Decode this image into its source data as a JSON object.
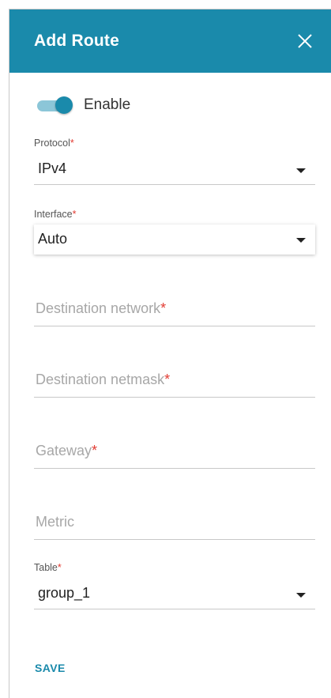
{
  "dialog": {
    "title": "Add Route",
    "close_icon": "close-icon"
  },
  "enable": {
    "label": "Enable",
    "state": "on"
  },
  "protocol": {
    "label": "Protocol",
    "required_mark": "*",
    "value": "IPv4"
  },
  "interface": {
    "label": "Interface",
    "required_mark": "*",
    "value": "Auto"
  },
  "destination_network": {
    "placeholder": "Destination network",
    "required_mark": "*"
  },
  "destination_netmask": {
    "placeholder": "Destination netmask",
    "required_mark": "*"
  },
  "gateway": {
    "placeholder": "Gateway",
    "required_mark": "*"
  },
  "metric": {
    "placeholder": "Metric"
  },
  "table": {
    "label": "Table",
    "required_mark": "*",
    "value": "group_1"
  },
  "actions": {
    "save_label": "SAVE"
  },
  "colors": {
    "accent": "#1a8aab",
    "required": "#e23b32"
  }
}
